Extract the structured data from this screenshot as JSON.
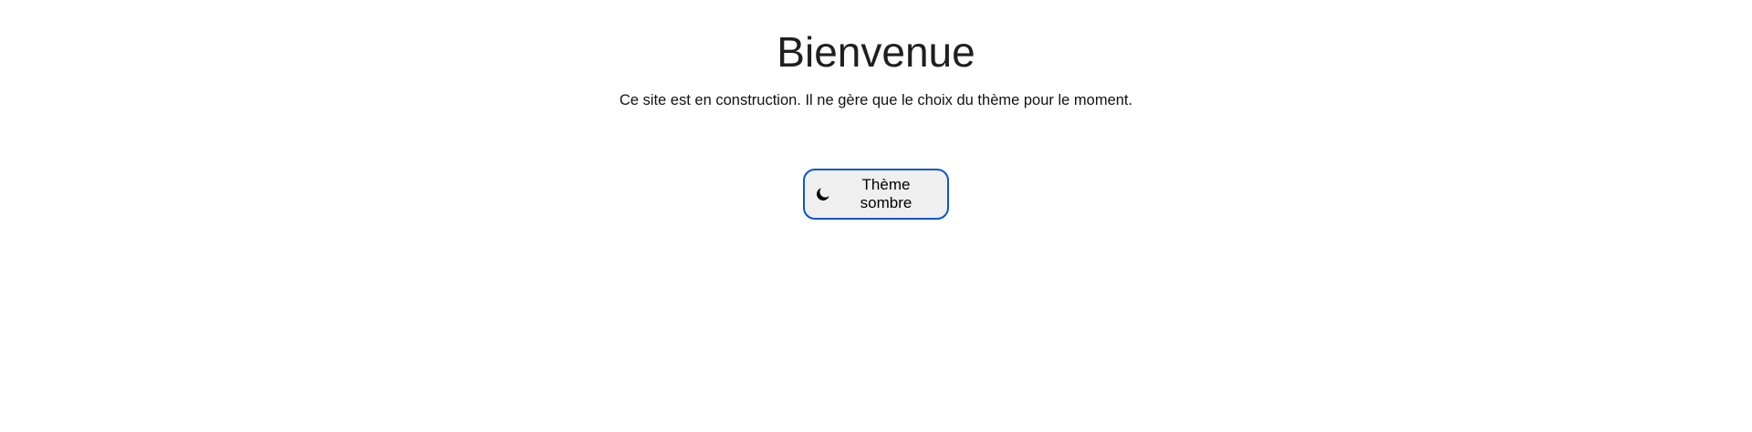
{
  "header": {
    "title": "Bienvenue",
    "subtitle": "Ce site est en construction. Il ne gère que le choix du thème pour le moment."
  },
  "theme_toggle": {
    "icon": "moon-icon",
    "label": "Thème sombre",
    "border_color": "#0b57d0",
    "background": "#efefef"
  }
}
